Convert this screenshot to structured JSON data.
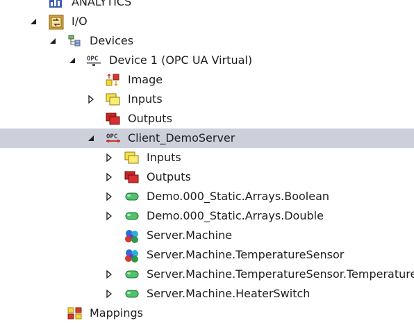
{
  "tree": {
    "nodes": [
      {
        "id": "analytics",
        "label": "ANALYTICS",
        "level": 1,
        "expander": "none",
        "icon": "analytics-icon",
        "selected": false
      },
      {
        "id": "io",
        "label": "I/O",
        "level": 1,
        "expander": "expanded",
        "icon": "io-icon",
        "selected": false
      },
      {
        "id": "devices",
        "label": "Devices",
        "level": 2,
        "expander": "expanded",
        "icon": "devices-icon",
        "selected": false
      },
      {
        "id": "device1",
        "label": "Device 1 (OPC UA Virtual)",
        "level": 3,
        "expander": "expanded",
        "icon": "opc-device-icon",
        "selected": false
      },
      {
        "id": "image",
        "label": "Image",
        "level": 4,
        "expander": "none",
        "icon": "image-icon",
        "selected": false
      },
      {
        "id": "inputs",
        "label": "Inputs",
        "level": 4,
        "expander": "collapsed",
        "icon": "inputs-icon",
        "selected": false
      },
      {
        "id": "outputs",
        "label": "Outputs",
        "level": 4,
        "expander": "none",
        "icon": "outputs-icon",
        "selected": false
      },
      {
        "id": "client",
        "label": "Client_DemoServer",
        "level": 4,
        "expander": "expanded",
        "icon": "opc-client-icon",
        "selected": true
      },
      {
        "id": "client-inputs",
        "label": "Inputs",
        "level": 5,
        "expander": "collapsed",
        "icon": "inputs-icon",
        "selected": false
      },
      {
        "id": "client-outputs",
        "label": "Outputs",
        "level": 5,
        "expander": "collapsed",
        "icon": "outputs-icon",
        "selected": false
      },
      {
        "id": "arr-bool",
        "label": "Demo.000_Static.Arrays.Boolean",
        "level": 5,
        "expander": "collapsed",
        "icon": "variable-icon",
        "selected": false
      },
      {
        "id": "arr-double",
        "label": "Demo.000_Static.Arrays.Double",
        "level": 5,
        "expander": "collapsed",
        "icon": "variable-icon",
        "selected": false
      },
      {
        "id": "machine",
        "label": "Server.Machine",
        "level": 5,
        "expander": "none",
        "icon": "object-icon",
        "selected": false
      },
      {
        "id": "temp-sensor",
        "label": "Server.Machine.TemperatureSensor",
        "level": 5,
        "expander": "none",
        "icon": "object-icon",
        "selected": false
      },
      {
        "id": "temp-value",
        "label": "Server.Machine.TemperatureSensor.Temperature",
        "level": 5,
        "expander": "collapsed",
        "icon": "variable-icon",
        "selected": false
      },
      {
        "id": "heater",
        "label": "Server.Machine.HeaterSwitch",
        "level": 5,
        "expander": "collapsed",
        "icon": "variable-icon",
        "selected": false
      },
      {
        "id": "mappings",
        "label": "Mappings",
        "level": 2,
        "expander": "none",
        "icon": "mappings-icon",
        "selected": false
      }
    ]
  },
  "colors": {
    "selection": "#cdd0db",
    "text": "#1e1e1e",
    "arrow": "#1e1e1e"
  }
}
